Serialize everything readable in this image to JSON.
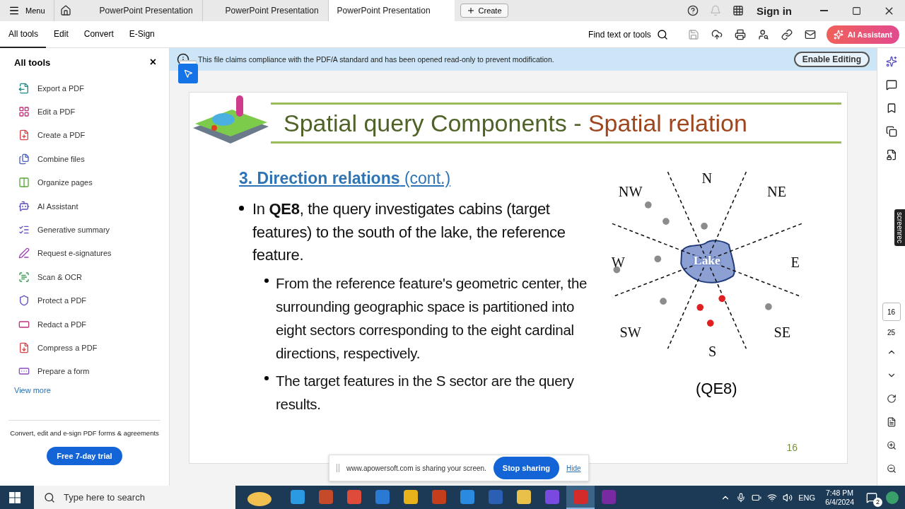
{
  "top_bar": {
    "menu_label": "Menu",
    "tabs": [
      {
        "label": "PowerPoint Presentation",
        "selected": false
      },
      {
        "label": "PowerPoint Presentation",
        "selected": false
      },
      {
        "label": "PowerPoint Presentation",
        "selected": true
      }
    ],
    "create_label": "Create",
    "sign_in": "Sign in"
  },
  "toolbar": {
    "tabs": [
      {
        "label": "All tools",
        "selected": true
      },
      {
        "label": "Edit",
        "selected": false
      },
      {
        "label": "Convert",
        "selected": false
      },
      {
        "label": "E-Sign",
        "selected": false
      }
    ],
    "find": "Find text or tools",
    "ai_button": "AI Assistant"
  },
  "left_panel": {
    "title": "All tools",
    "close": "×",
    "items": [
      {
        "label": "Export a PDF"
      },
      {
        "label": "Edit a PDF"
      },
      {
        "label": "Create a PDF"
      },
      {
        "label": "Combine files"
      },
      {
        "label": "Organize pages"
      },
      {
        "label": "AI Assistant"
      },
      {
        "label": "Generative summary"
      },
      {
        "label": "Request e-signatures"
      },
      {
        "label": "Scan & OCR"
      },
      {
        "label": "Protect a PDF"
      },
      {
        "label": "Redact a PDF"
      },
      {
        "label": "Compress a PDF"
      },
      {
        "label": "Prepare a form"
      }
    ],
    "view_more": "View more",
    "promo": "Convert, edit and e-sign PDF forms & agreements",
    "trial_button": "Free 7-day trial"
  },
  "info_bar": {
    "message": "This file claims compliance with the PDF/A standard and has been opened read-only to prevent modification.",
    "button": "Enable Editing"
  },
  "slide": {
    "title_main": "Spatial query Components - ",
    "title_accent": "Spatial relation",
    "heading": "**3. Direction relations** (cont.)",
    "bullets": [
      {
        "text": "In **QE8**, the query investigates cabins (target features) to the south of the lake, the reference feature.",
        "children": [
          {
            "text": "From the reference feature's geometric center, the surrounding geographic space is partitioned into eight sectors corresponding to the eight cardinal directions, respectively."
          },
          {
            "text": " The target features in the S sector are the query results."
          }
        ]
      }
    ],
    "diagram": {
      "directions": [
        "N",
        "NE",
        "E",
        "SE",
        "S",
        "SW",
        "W",
        "NW"
      ],
      "lake_label": "Lake",
      "points": [
        {
          "color": "#8c8c8c"
        },
        {
          "color": "#8c8c8c"
        },
        {
          "color": "#8c8c8c"
        },
        {
          "color": "#8c8c8c"
        },
        {
          "color": "#8c8c8c"
        },
        {
          "color": "#8c8c8c"
        },
        {
          "color": "#8c8c8c"
        },
        {
          "color": "#e02020"
        },
        {
          "color": "#e02020"
        },
        {
          "color": "#e02020"
        }
      ]
    },
    "caption": "(QE8)",
    "page_number": "16"
  },
  "share_bar": {
    "message": "www.apowersoft.com is sharing your screen.",
    "stop": "Stop sharing",
    "hide": "Hide"
  },
  "right_rail": {
    "badge": "screenrec",
    "current_page": "16",
    "total_pages": "25"
  },
  "taskbar": {
    "search_placeholder": "Type here to search",
    "language": "ENG",
    "time": "7:48 PM",
    "date": "6/4/2024",
    "notifications": "2"
  }
}
